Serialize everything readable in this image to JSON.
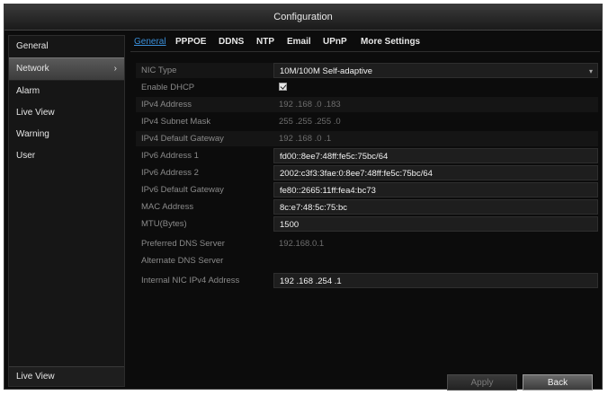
{
  "window": {
    "title": "Configuration"
  },
  "sidebar": {
    "items": [
      {
        "label": "General"
      },
      {
        "label": "Network",
        "chevron": "›"
      },
      {
        "label": "Alarm"
      },
      {
        "label": "Live View"
      },
      {
        "label": "Warning"
      },
      {
        "label": "User"
      }
    ],
    "active_index": 1,
    "bottom_label": "Live View"
  },
  "tabs": [
    {
      "label": "General"
    },
    {
      "label": "PPPOE"
    },
    {
      "label": "DDNS"
    },
    {
      "label": "NTP"
    },
    {
      "label": "Email"
    },
    {
      "label": "UPnP"
    },
    {
      "label": "More Settings"
    }
  ],
  "active_tab": "General",
  "fields": {
    "nic_type": {
      "label": "NIC Type",
      "value": "10M/100M Self-adaptive",
      "arrow": "▾"
    },
    "enable_dhcp": {
      "label": "Enable DHCP",
      "checked": true
    },
    "ipv4_address": {
      "label": "IPv4 Address",
      "value": "192 .168 .0    .183"
    },
    "ipv4_mask": {
      "label": "IPv4 Subnet Mask",
      "value": "255 .255 .255 .0"
    },
    "ipv4_gateway": {
      "label": "IPv4 Default Gateway",
      "value": "192 .168 .0    .1"
    },
    "ipv6_address1": {
      "label": "IPv6 Address 1",
      "value": "fd00::8ee7:48ff:fe5c:75bc/64"
    },
    "ipv6_address2": {
      "label": "IPv6 Address 2",
      "value": "2002:c3f3:3fae:0:8ee7:48ff:fe5c:75bc/64"
    },
    "ipv6_gateway": {
      "label": "IPv6 Default Gateway",
      "value": "fe80::2665:11ff:fea4:bc73"
    },
    "mac_address": {
      "label": "MAC Address",
      "value": "8c:e7:48:5c:75:bc"
    },
    "mtu": {
      "label": "MTU(Bytes)",
      "value": "1500"
    },
    "dns_preferred": {
      "label": "Preferred DNS Server",
      "value": "192.168.0.1"
    },
    "dns_alternate": {
      "label": "Alternate DNS Server",
      "value": ""
    },
    "internal_nic": {
      "label": "Internal NIC IPv4 Address",
      "value": "192 .168 .254 .1"
    }
  },
  "buttons": {
    "apply": "Apply",
    "back": "Back"
  }
}
